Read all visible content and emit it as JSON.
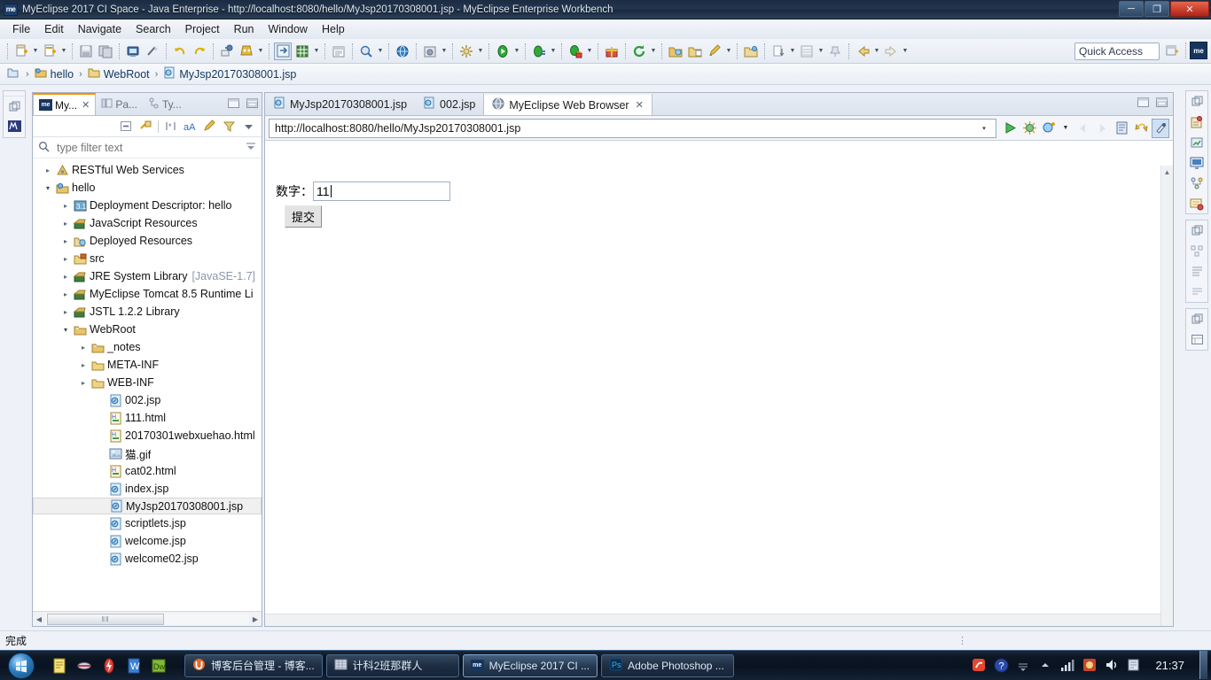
{
  "window": {
    "title": "MyEclipse 2017 CI Space - Java Enterprise - http://localhost:8080/hello/MyJsp20170308001.jsp - MyEclipse Enterprise Workbench",
    "app_badge": "me",
    "minimize": "─",
    "maximize": "❐",
    "close": "✕"
  },
  "menu": {
    "items": [
      {
        "label": "File"
      },
      {
        "label": "Edit"
      },
      {
        "label": "Navigate"
      },
      {
        "label": "Search"
      },
      {
        "label": "Project"
      },
      {
        "label": "Run"
      },
      {
        "label": "Window"
      },
      {
        "label": "Help"
      }
    ]
  },
  "toolbar": {
    "quick_access": "Quick Access",
    "perspective_badge": "me",
    "icons": [
      "new-wizard-icon",
      "new-wizard-dropdown",
      "new-jsp-icon",
      "new-jsp-dropdown",
      "save-icon",
      "save-all-icon",
      "print-icon",
      "toggle-markoccurrences-icon",
      "undo-icon",
      "redo-icon",
      "deploy-icon",
      "run-server-icon",
      "run-server-dropdown",
      "open-browser-icon",
      "database-explorer-icon",
      "database-dropdown",
      "report-icon",
      "search-icon",
      "search-dropdown",
      "open-type-icon",
      "snapshot-icon",
      "snapshot-dropdown",
      "configure-icon",
      "configure-dropdown",
      "run-icon",
      "run-dropdown",
      "debug-icon",
      "debug-dropdown",
      "run-secure-icon",
      "run-secure-dropdown",
      "profile-dropdown",
      "gift-icon",
      "refresh-icon",
      "refresh-dropdown",
      "open-folder-icon",
      "open-folder2-icon",
      "edit-icon",
      "edit-dropdown",
      "open-perspective-icon",
      "next-annotation-icon",
      "next-annotation-dropdown",
      "list-icon",
      "list-dropdown",
      "pin-icon",
      "back-icon",
      "back-dropdown",
      "forward-icon",
      "forward-dropdown"
    ]
  },
  "breadcrumb": {
    "root_icon": "perspective-icon",
    "items": [
      {
        "label": "hello",
        "icon": "project-icon"
      },
      {
        "label": "WebRoot",
        "icon": "folder-icon"
      },
      {
        "label": "MyJsp20170308001.jsp",
        "icon": "jsp-icon"
      }
    ],
    "separator": "›"
  },
  "explorer": {
    "tabs": [
      {
        "label": "My...",
        "icon": "myeclipse-explorer-icon",
        "active": true,
        "closable": true
      },
      {
        "label": "Pa...",
        "icon": "package-explorer-icon",
        "active": false
      },
      {
        "label": "Ty...",
        "icon": "type-hierarchy-icon",
        "active": false
      }
    ],
    "tab_icons": [
      "minimize-view-icon",
      "maximize-view-icon"
    ],
    "toolbar_icons": [
      "collapse-all-icon",
      "link-with-editor-icon",
      "select-working-set-icon",
      "alphabetic-sort-icon",
      "customize-icon",
      "filters-icon",
      "view-menu-icon"
    ],
    "filter_placeholder": "type filter text",
    "filter_value": "",
    "search_icon": "search-icon",
    "tree": [
      {
        "label": "RESTful Web Services",
        "indent": 0,
        "twisty": "collapsed",
        "icon": "restful-icon"
      },
      {
        "label": "hello",
        "indent": 0,
        "twisty": "expanded",
        "icon": "project-icon"
      },
      {
        "label": "Deployment Descriptor: hello",
        "indent": 1,
        "twisty": "collapsed",
        "icon": "descriptor-icon"
      },
      {
        "label": "JavaScript Resources",
        "indent": 1,
        "twisty": "collapsed",
        "icon": "library-icon"
      },
      {
        "label": "Deployed Resources",
        "indent": 1,
        "twisty": "collapsed",
        "icon": "deployed-icon"
      },
      {
        "label": "src",
        "indent": 1,
        "twisty": "collapsed",
        "icon": "source-folder-icon"
      },
      {
        "label": "JRE System Library",
        "sub": "[JavaSE-1.7]",
        "indent": 1,
        "twisty": "collapsed",
        "icon": "library-icon"
      },
      {
        "label": "MyEclipse Tomcat 8.5 Runtime Li",
        "indent": 1,
        "twisty": "collapsed",
        "icon": "library-icon"
      },
      {
        "label": "JSTL 1.2.2 Library",
        "indent": 1,
        "twisty": "collapsed",
        "icon": "library-icon"
      },
      {
        "label": "WebRoot",
        "indent": 1,
        "twisty": "expanded",
        "icon": "webroot-folder-icon"
      },
      {
        "label": "_notes",
        "indent": 2,
        "twisty": "collapsed",
        "icon": "webroot-folder-icon"
      },
      {
        "label": "META-INF",
        "indent": 2,
        "twisty": "collapsed",
        "icon": "folder-icon"
      },
      {
        "label": "WEB-INF",
        "indent": 2,
        "twisty": "collapsed",
        "icon": "folder-icon"
      },
      {
        "label": "002.jsp",
        "indent": 3,
        "twisty": "none",
        "icon": "jsp-icon"
      },
      {
        "label": "111.html",
        "indent": 3,
        "twisty": "none",
        "icon": "html-icon"
      },
      {
        "label": "20170301webxuehao.html",
        "indent": 3,
        "twisty": "none",
        "icon": "html-icon"
      },
      {
        "label": "猫.gif",
        "indent": 3,
        "twisty": "none",
        "icon": "image-icon"
      },
      {
        "label": "cat02.html",
        "indent": 3,
        "twisty": "none",
        "icon": "html-icon"
      },
      {
        "label": "index.jsp",
        "indent": 3,
        "twisty": "none",
        "icon": "jsp-icon"
      },
      {
        "label": "MyJsp20170308001.jsp",
        "indent": 3,
        "twisty": "none",
        "icon": "jsp-icon",
        "selected": true
      },
      {
        "label": "scriptlets.jsp",
        "indent": 3,
        "twisty": "none",
        "icon": "jsp-icon"
      },
      {
        "label": "welcome.jsp",
        "indent": 3,
        "twisty": "none",
        "icon": "jsp-icon"
      },
      {
        "label": "welcome02.jsp",
        "indent": 3,
        "twisty": "none",
        "icon": "jsp-icon"
      }
    ],
    "scroll_thumb_glyph": "‖‖"
  },
  "editor": {
    "tabs": [
      {
        "label": "MyJsp20170308001.jsp",
        "icon": "jsp-icon",
        "active": false,
        "closable": false
      },
      {
        "label": "002.jsp",
        "icon": "jsp-icon",
        "active": false,
        "closable": false
      },
      {
        "label": "MyEclipse Web Browser",
        "icon": "browser-icon",
        "active": true,
        "closable": true
      }
    ],
    "tab_close": "✕",
    "tab_icons": [
      "minimize-editor-icon",
      "maximize-editor-icon"
    ],
    "browser": {
      "url": "http://localhost:8080/hello/MyJsp20170308001.jsp",
      "url_dropdown": "▾",
      "tools": [
        "go-icon",
        "debug-browser-icon",
        "new-browser-icon",
        "new-browser-dropdown",
        "back-icon",
        "forward-icon",
        "view-source-icon",
        "refresh-icon",
        "browser-settings-icon"
      ],
      "page": {
        "form_label": "数字：",
        "input_value": "11",
        "submit_label": "提交"
      }
    }
  },
  "left_fastview": {
    "icons": [
      "restore-view-icon",
      "myeclipse-explorer-icon"
    ]
  },
  "right_fastview": {
    "groups": [
      {
        "icons": [
          "restore-view-icon",
          "servers-icon",
          "snippets-icon",
          "console-icon",
          "outline-icon",
          "db-browser-icon"
        ]
      },
      {
        "icons": [
          "restore-view-icon",
          "structure-icon",
          "properties-icon",
          "problems-icon"
        ]
      },
      {
        "icons": [
          "restore-view-icon",
          "task-list-icon"
        ]
      }
    ]
  },
  "status": {
    "text": "完成",
    "dots": "⋮"
  },
  "taskbar": {
    "start_label": "start-orb",
    "quick_launch": [
      {
        "name": "notes-icon"
      },
      {
        "name": "media-icon"
      },
      {
        "name": "thunder-download-icon"
      },
      {
        "name": "wps-writer-icon"
      },
      {
        "name": "dreamweaver-icon"
      }
    ],
    "tasks": [
      {
        "label": "博客后台管理 - 博客...",
        "icon": "browser-u-icon",
        "active": false
      },
      {
        "label": "计科2班那群人",
        "icon": "qq-group-icon",
        "active": false
      },
      {
        "label": "MyEclipse 2017 CI ...",
        "icon": "myeclipse-icon",
        "active": true
      },
      {
        "label": "Adobe Photoshop ...",
        "icon": "photoshop-icon",
        "active": false
      }
    ],
    "tray": [
      {
        "name": "sogou-input-icon"
      },
      {
        "name": "help-icon"
      },
      {
        "name": "show-hidden-icons-icon"
      },
      {
        "name": "network-icon"
      },
      {
        "name": "antivirus-icon"
      },
      {
        "name": "volume-icon"
      },
      {
        "name": "action-center-icon"
      }
    ],
    "clock": "21:37"
  },
  "colors": {
    "accent_orange": "#f29100",
    "titlebar_dark": "#1b2b42",
    "close_red": "#b02218",
    "selection_gray": "#f0f0f0",
    "link_blue": "#12355e"
  }
}
